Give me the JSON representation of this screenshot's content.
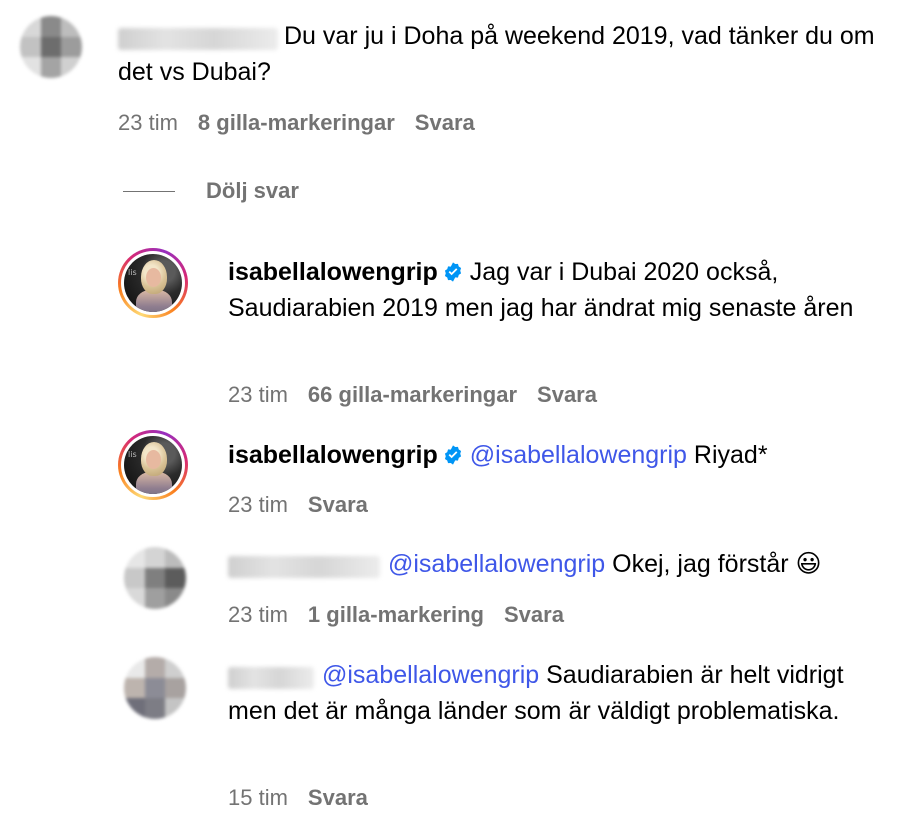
{
  "comments": [
    {
      "text": "Du var ju i Doha på weekend 2019, vad tänker du om det vs Dubai?",
      "time": "23 tim",
      "likes": "8 gilla-markeringar",
      "reply": "Svara"
    }
  ],
  "toggle_replies": {
    "label": "Dölj svar"
  },
  "replies": [
    {
      "username": "isabellalowengrip",
      "text": "Jag var i Dubai 2020 också, Saudiarabien 2019 men jag har ändrat mig senaste åren",
      "time": "23 tim",
      "likes": "66 gilla-markeringar",
      "reply": "Svara"
    },
    {
      "username": "isabellalowengrip",
      "mention": "@isabellalowengrip",
      "text": "Riyad*",
      "time": "23 tim",
      "reply": "Svara"
    },
    {
      "mention": "@isabellalowengrip",
      "text": "Okej, jag förstår",
      "emoji": "😃",
      "time": "23 tim",
      "likes": "1 gilla-markering",
      "reply": "Svara"
    },
    {
      "mention": "@isabellalowengrip",
      "text": "Saudiarabien är helt vidrigt men det är många länder som är väldigt problematiska.",
      "time": "15 tim",
      "reply": "Svara"
    }
  ],
  "colors": {
    "mention": "#3f57e8",
    "meta": "#737373",
    "verified": "#0095f6"
  },
  "icons": {
    "verified": "verified-badge-icon"
  }
}
